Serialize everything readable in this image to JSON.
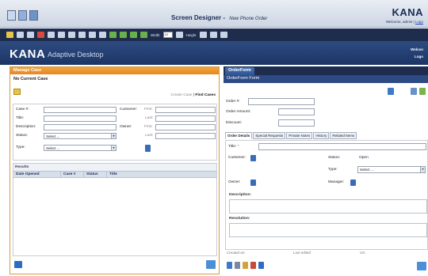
{
  "header": {
    "title": "Screen Designer",
    "subtitle": "New Phone Order",
    "brand": "KANA",
    "welcome": "Welcome, admin | ",
    "logout_link": "Logo"
  },
  "toolbar": {
    "width_label": "Width",
    "width_value": "10",
    "height_label": "Height"
  },
  "brandbar": {
    "kana": "KANA",
    "product": "Adaptive Desktop",
    "welcome": "Welcon",
    "logout": "Logo"
  },
  "manage_case": {
    "header": "Manage Case",
    "current": "No Current Case",
    "create_case": "Create Case",
    "find_cases": "Find Cases",
    "fields": {
      "case_no": "Case #:",
      "title": "Title:",
      "description": "Description:",
      "status": "Status:",
      "type": "Type:",
      "customer": "Customer:",
      "owner": "Owner:",
      "first": "First:",
      "last": "Last:"
    },
    "status_value": "Select ...",
    "type_value": "Select ...",
    "results": {
      "title": "Results",
      "columns": [
        "Date Opened",
        "Case #",
        "Status",
        "Title"
      ]
    }
  },
  "order_form": {
    "tab": "OrderForm",
    "title": "OrderForm Form",
    "order_no": "Order #:",
    "order_amount": "Order Amount:",
    "discount": "Discount:",
    "subtabs": [
      "Order Details",
      "Special Requests",
      "Private Notes",
      "History",
      "Related Items"
    ],
    "details": {
      "title_label": "Title:",
      "required_mark": "*",
      "customer": "Customer:",
      "status_label": "Status:",
      "status_value": "Open",
      "type_label": "Type:",
      "type_value": "Select ...",
      "owner": "Owner:",
      "manager": "Manager:",
      "description": "Description:",
      "resolution": "Resolution:"
    },
    "meta": {
      "created": "Created on:",
      "last_edited": "Last edited",
      "on": "On:"
    }
  },
  "colors": {
    "manage_case_header": "#e8851e",
    "toolbar": "#1e2d4e",
    "order_form_header": "#2d4a85"
  }
}
